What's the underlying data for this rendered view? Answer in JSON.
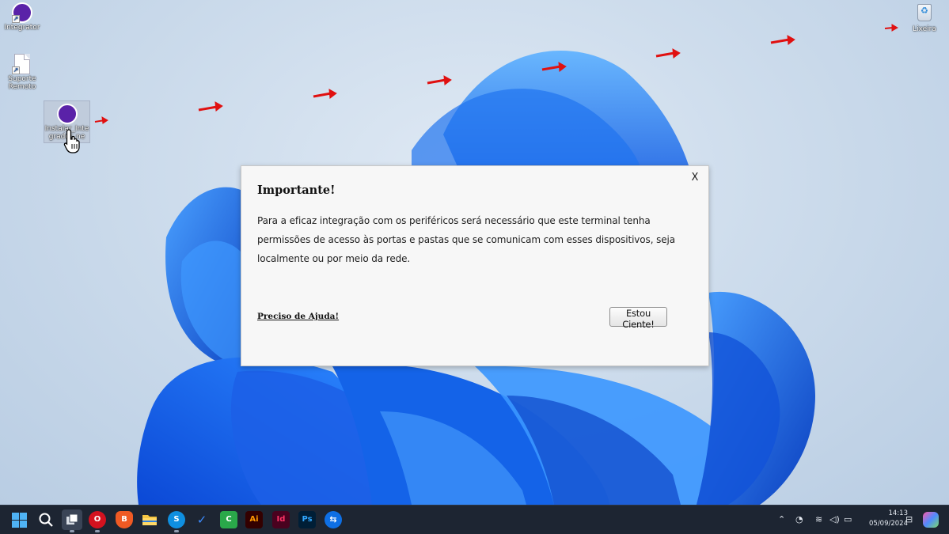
{
  "desktop": {
    "icons": [
      {
        "label": "Integrator"
      },
      {
        "label": "Suporte Remoto"
      },
      {
        "label": "Instalar_Integrador_ne"
      },
      {
        "label": "Lixeira"
      }
    ]
  },
  "dialog": {
    "title": "Importante!",
    "message": "Para a eficaz integração com os periféricos será necessário que este terminal tenha permissões de acesso às portas e pastas que se comunicam com esses dispositivos, seja localmente ou por meio da rede.",
    "close_label": "X",
    "help_link": "Preciso de Ajuda!",
    "ok_button": "Estou Ciente!"
  },
  "taskbar": {
    "apps": [
      {
        "icon": "windows-start-icon"
      },
      {
        "icon": "search-icon"
      },
      {
        "icon": "task-view-icon"
      },
      {
        "icon": "opera-icon",
        "label": "O"
      },
      {
        "icon": "brave-icon",
        "label": "B"
      },
      {
        "icon": "file-explorer-icon"
      },
      {
        "icon": "skype-icon",
        "label": "S"
      },
      {
        "icon": "todo-icon",
        "label": "✓"
      },
      {
        "icon": "camtasia-icon",
        "label": "C"
      },
      {
        "icon": "illustrator-icon",
        "label": "Ai"
      },
      {
        "icon": "indesign-icon",
        "label": "Id"
      },
      {
        "icon": "photoshop-icon",
        "label": "Ps"
      },
      {
        "icon": "teamviewer-icon",
        "label": "⇆"
      }
    ],
    "tray": {
      "time": "14:13",
      "date": "05/09/2024"
    }
  },
  "colors": {
    "dialog_bg": "#f7f7f7",
    "taskbar_bg": "#1d2532",
    "arrow_red": "#e01010",
    "bloom_blue": "#1565e0"
  }
}
